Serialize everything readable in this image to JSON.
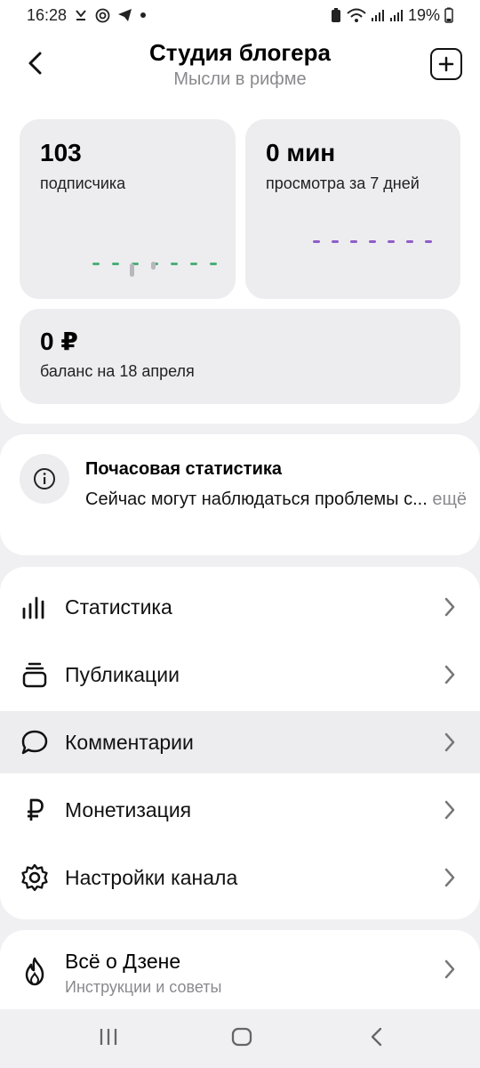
{
  "status_bar": {
    "time": "16:28",
    "battery": "19%",
    "left_icons": [
      "missed-call-icon",
      "at-sign-icon",
      "telegram-icon",
      "dot-icon"
    ],
    "right_icons": [
      "battery-saver-icon",
      "wifi-icon",
      "signal-icon",
      "signal-icon",
      "battery-icon"
    ]
  },
  "header": {
    "title": "Студия блогера",
    "subtitle": "Мысли в рифме",
    "back_icon": "chevron-left-icon",
    "add_icon": "plus-square-icon"
  },
  "stats": {
    "subscribers": {
      "value": "103",
      "label": "подписчика",
      "chart_color": "#4caf78",
      "bar_color": "#b8b8bc"
    },
    "views": {
      "value": "0 мин",
      "label": "просмотра за 7 дней",
      "chart_color": "#8f5ec8"
    },
    "balance": {
      "value": "0 ₽",
      "label": "баланс на 18 апреля"
    }
  },
  "notice": {
    "icon": "info-icon",
    "title": "Почасовая статистика",
    "text": "Сейчас могут наблюдаться проблемы с...",
    "more": "ещё"
  },
  "menu": {
    "items": [
      {
        "label": "Статистика",
        "icon": "bar-chart-icon"
      },
      {
        "label": "Публикации",
        "icon": "stack-icon"
      },
      {
        "label": "Комментарии",
        "icon": "chat-bubble-icon",
        "active": true
      },
      {
        "label": "Монетизация",
        "icon": "ruble-icon"
      },
      {
        "label": "Настройки канала",
        "icon": "gear-icon"
      }
    ]
  },
  "about": {
    "title": "Всё о Дзене",
    "subtitle": "Инструкции и советы",
    "icon": "flame-icon"
  },
  "navbar": {
    "icons": [
      "recents-icon",
      "home-icon",
      "back-icon"
    ]
  }
}
